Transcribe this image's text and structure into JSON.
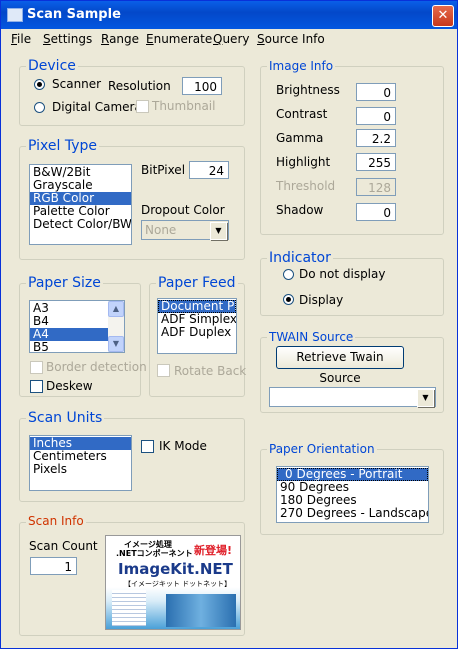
{
  "window": {
    "title": "Scan Sample",
    "close_glyph": "✕"
  },
  "menu": [
    {
      "label": "File",
      "accel": "F",
      "rest": "ile"
    },
    {
      "label": "Settings",
      "accel": "S",
      "rest": "ettings"
    },
    {
      "label": "Range",
      "accel": "R",
      "rest": "ange"
    },
    {
      "label": "Enumerate",
      "accel": "E",
      "rest": "numerate"
    },
    {
      "label": "Query",
      "accel": "Q",
      "rest": "uery"
    },
    {
      "label": "Source Info",
      "accel": "S",
      "rest": "ource Info"
    }
  ],
  "device": {
    "title": "Device",
    "scanner": "Scanner",
    "digital_camera": "Digital Camera",
    "resolution_label": "Resolution",
    "resolution_value": "100",
    "thumbnail": "Thumbnail",
    "selected": "Scanner"
  },
  "pixel_type": {
    "title": "Pixel Type",
    "items": [
      "B&W/2Bit",
      "Grayscale",
      "RGB Color",
      "Palette Color",
      "Detect Color/BW"
    ],
    "selected": "RGB Color",
    "bitpixel_label": "BitPixel",
    "bitpixel_value": "24",
    "dropout_label": "Dropout Color",
    "dropout_value": "None"
  },
  "paper_size": {
    "title": "Paper Size",
    "items": [
      "A3",
      "B4",
      "A4",
      "B5"
    ],
    "selected": "A4",
    "border_detection": "Border detection",
    "deskew": "Deskew"
  },
  "paper_feed": {
    "title": "Paper Feed",
    "items": [
      "Document Plate",
      "ADF Simplex",
      "ADF Duplex"
    ],
    "selected": "Document Plate",
    "rotate_back": "Rotate Back"
  },
  "scan_units": {
    "title": "Scan Units",
    "items": [
      "Inches",
      "Centimeters",
      "Pixels"
    ],
    "selected": "Inches",
    "ik_mode": "IK Mode"
  },
  "scan_info": {
    "title": "Scan Info",
    "count_label": "Scan Count",
    "count_value": "1",
    "ad_line1": "イメージ処理",
    "ad_line2": ".NETコンポーネント",
    "ad_new": "新登場!",
    "ad_brand": "ImageKit.NET",
    "ad_sub": "【イメージキット ドットネット】"
  },
  "image_info": {
    "title": "Image Info",
    "fields": [
      {
        "label": "Brightness",
        "value": "0",
        "enabled": true
      },
      {
        "label": "Contrast",
        "value": "0",
        "enabled": true
      },
      {
        "label": "Gamma",
        "value": "2.2",
        "enabled": true
      },
      {
        "label": "Highlight",
        "value": "255",
        "enabled": true
      },
      {
        "label": "Threshold",
        "value": "128",
        "enabled": false
      },
      {
        "label": "Shadow",
        "value": "0",
        "enabled": true
      }
    ]
  },
  "indicator": {
    "title": "Indicator",
    "do_not_display": "Do not display",
    "display": "Display",
    "selected": "Display"
  },
  "twain": {
    "title": "TWAIN Source",
    "retrieve_button": "Retrieve  Twain Source",
    "source_value": ""
  },
  "orientation": {
    "title": "Paper Orientation",
    "items": [
      "0 Degrees - Portrait",
      "90 Degrees",
      "180 Degrees",
      "270 Degrees - Landscape"
    ],
    "selected": "0 Degrees - Portrait"
  },
  "colors": {
    "title_bar": "#0348c9",
    "accent": "#0046d5",
    "selection": "#316ac5",
    "face": "#ece9d8"
  }
}
